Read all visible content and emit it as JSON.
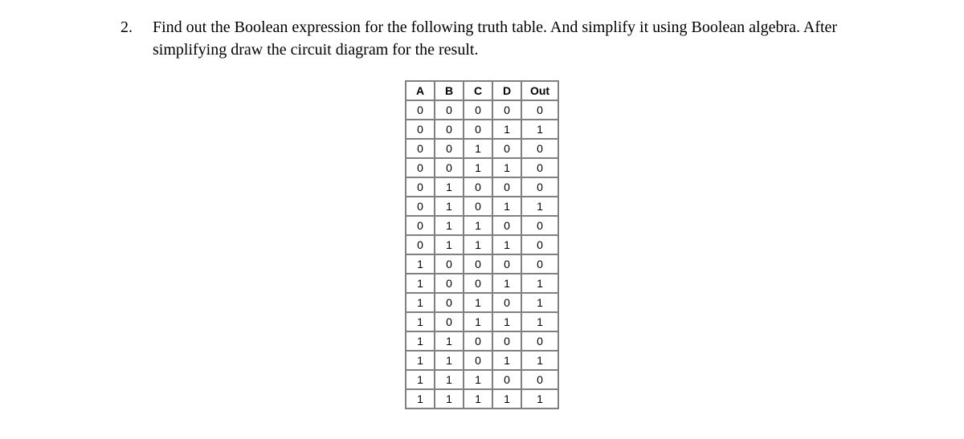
{
  "question": {
    "number": "2.",
    "text": "Find out the Boolean expression for the following truth table. And simplify it using Boolean algebra. After simplifying draw the circuit diagram for the result."
  },
  "chart_data": {
    "type": "table",
    "title": "",
    "headers": [
      "A",
      "B",
      "C",
      "D",
      "Out"
    ],
    "rows": [
      [
        "0",
        "0",
        "0",
        "0",
        "0"
      ],
      [
        "0",
        "0",
        "0",
        "1",
        "1"
      ],
      [
        "0",
        "0",
        "1",
        "0",
        "0"
      ],
      [
        "0",
        "0",
        "1",
        "1",
        "0"
      ],
      [
        "0",
        "1",
        "0",
        "0",
        "0"
      ],
      [
        "0",
        "1",
        "0",
        "1",
        "1"
      ],
      [
        "0",
        "1",
        "1",
        "0",
        "0"
      ],
      [
        "0",
        "1",
        "1",
        "1",
        "0"
      ],
      [
        "1",
        "0",
        "0",
        "0",
        "0"
      ],
      [
        "1",
        "0",
        "0",
        "1",
        "1"
      ],
      [
        "1",
        "0",
        "1",
        "0",
        "1"
      ],
      [
        "1",
        "0",
        "1",
        "1",
        "1"
      ],
      [
        "1",
        "1",
        "0",
        "0",
        "0"
      ],
      [
        "1",
        "1",
        "0",
        "1",
        "1"
      ],
      [
        "1",
        "1",
        "1",
        "0",
        "0"
      ],
      [
        "1",
        "1",
        "1",
        "1",
        "1"
      ]
    ]
  }
}
